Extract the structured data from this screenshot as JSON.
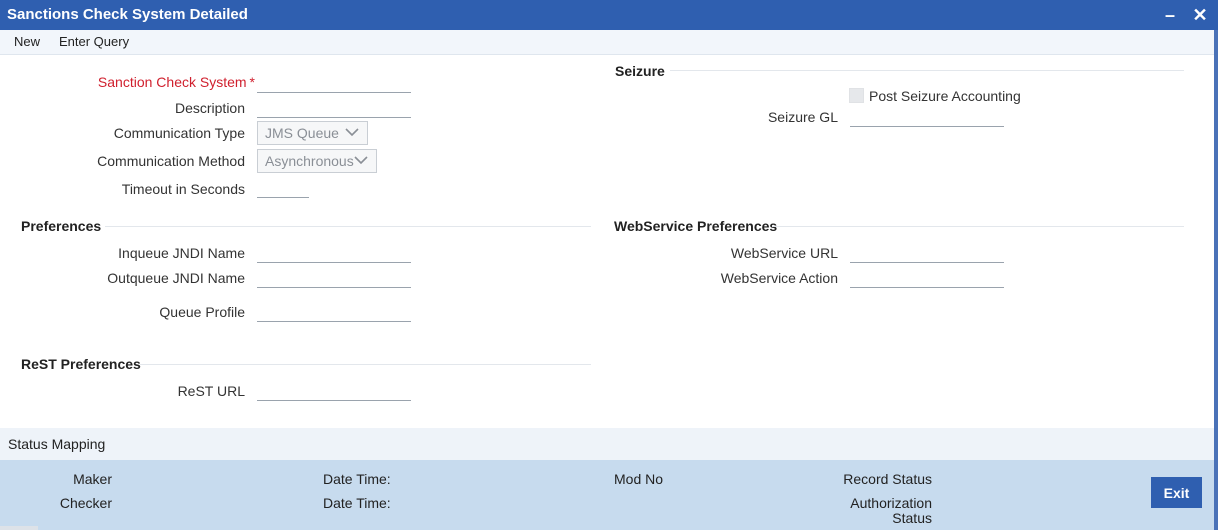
{
  "window": {
    "title": "Sanctions Check System Detailed",
    "minimize_label": "–",
    "close_label": "✕"
  },
  "menu": {
    "new_label": "New",
    "enter_query_label": "Enter Query"
  },
  "main": {
    "sanction_check_system": {
      "label": "Sanction Check System",
      "required_mark": "*",
      "value": ""
    },
    "description": {
      "label": "Description",
      "value": ""
    },
    "communication_type": {
      "label": "Communication Type",
      "selected": "JMS Queue"
    },
    "communication_method": {
      "label": "Communication Method",
      "selected": "Asynchronous"
    },
    "timeout": {
      "label": "Timeout in Seconds",
      "value": ""
    }
  },
  "preferences": {
    "title": "Preferences",
    "inqueue_jndi": {
      "label": "Inqueue JNDI Name",
      "value": ""
    },
    "outqueue_jndi": {
      "label": "Outqueue JNDI Name",
      "value": ""
    },
    "queue_profile": {
      "label": "Queue Profile",
      "value": ""
    }
  },
  "rest": {
    "title": "ReST Preferences",
    "rest_url": {
      "label": "ReST URL",
      "value": ""
    }
  },
  "seizure": {
    "title": "Seizure",
    "post_seizure_accounting": {
      "label": "Post Seizure Accounting",
      "checked": false
    },
    "seizure_gl": {
      "label": "Seizure GL",
      "value": ""
    }
  },
  "webservice": {
    "title": "WebService Preferences",
    "url": {
      "label": "WebService URL",
      "value": ""
    },
    "action": {
      "label": "WebService Action",
      "value": ""
    }
  },
  "status_mapping": {
    "label": "Status Mapping"
  },
  "footer": {
    "maker_label": "Maker",
    "checker_label": "Checker",
    "date_time_label_1": "Date Time:",
    "date_time_label_2": "Date Time:",
    "mod_no_label": "Mod No",
    "record_status_label": "Record Status",
    "authorization_status_line1": "Authorization",
    "authorization_status_line2": "Status",
    "exit_label": "Exit"
  },
  "colors": {
    "title_bar": "#2f5fb0",
    "required": "#d0202e",
    "footer_bg": "#c7dbee",
    "exit_button": "#2f5fb0"
  }
}
